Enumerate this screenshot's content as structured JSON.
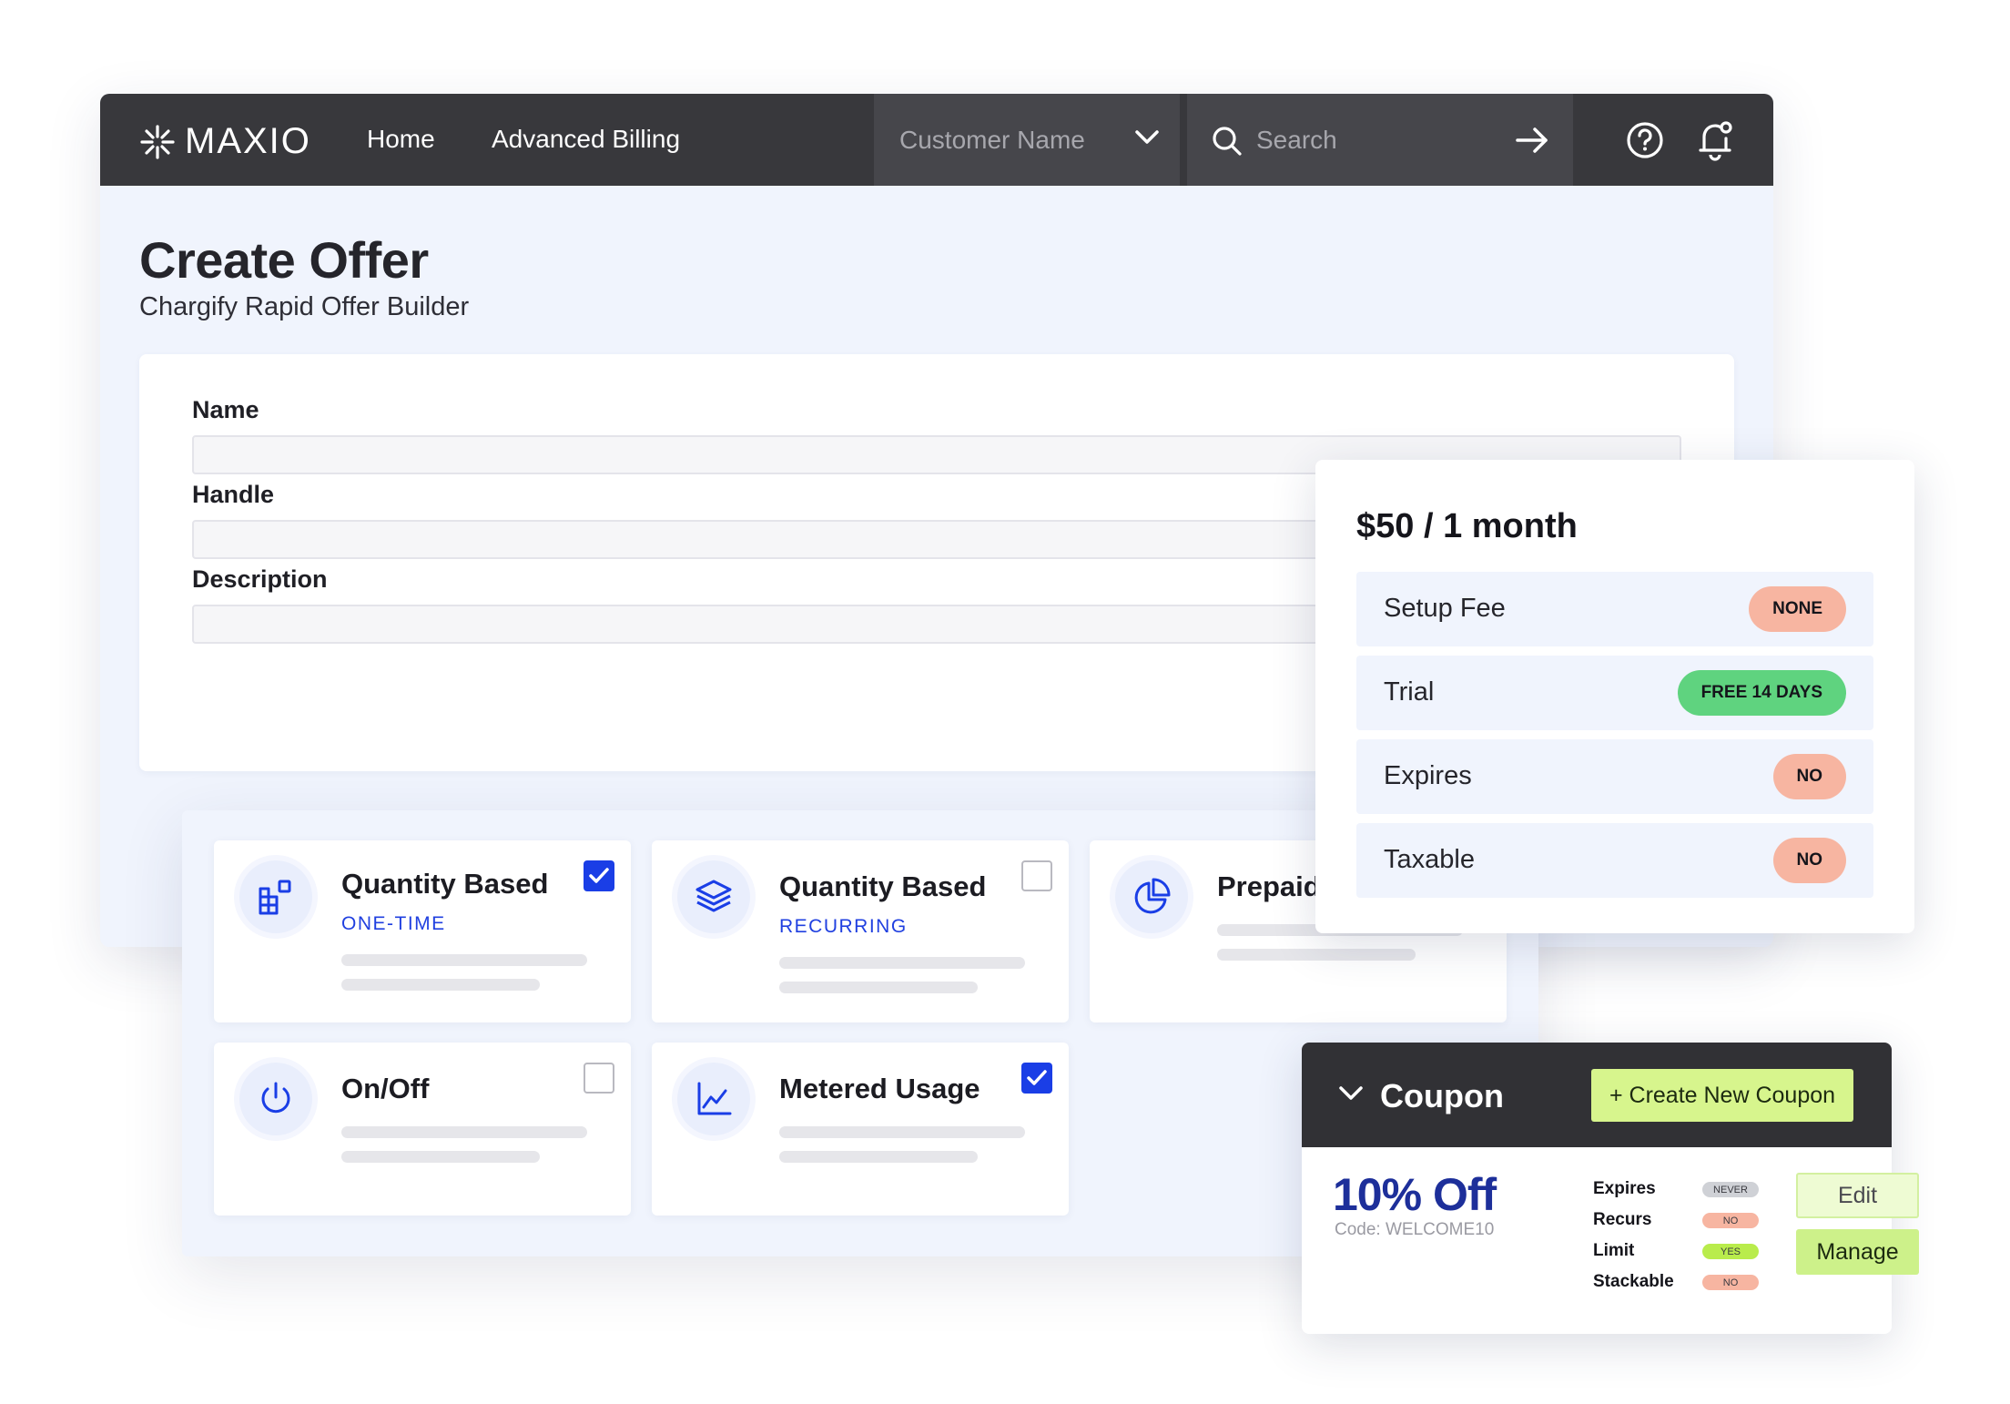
{
  "app": {
    "logo_text": "MAXIO",
    "nav": {
      "home": "Home",
      "advanced_billing": "Advanced Billing"
    },
    "customer_select": {
      "placeholder": "Customer Name"
    },
    "search": {
      "placeholder": "Search"
    },
    "icons": [
      "help-icon",
      "bell-icon",
      "search-icon",
      "arrow-right-icon",
      "chevron-down-icon"
    ]
  },
  "page": {
    "title": "Create Offer",
    "subtitle": "Chargify Rapid Offer Builder"
  },
  "form": {
    "fields": [
      {
        "label": "Name",
        "value": ""
      },
      {
        "label": "Handle",
        "value": ""
      },
      {
        "label": "Description",
        "value": ""
      }
    ]
  },
  "product_types": [
    {
      "title": "Quantity Based",
      "subtitle": "ONE-TIME",
      "checked": true,
      "icon": "blocks-icon"
    },
    {
      "title": "Quantity Based",
      "subtitle": "RECURRING",
      "checked": false,
      "icon": "layers-icon"
    },
    {
      "title": "Prepaid",
      "subtitle": "",
      "checked": false,
      "icon": "pie-chart-icon"
    },
    {
      "title": "On/Off",
      "subtitle": "",
      "checked": false,
      "icon": "power-icon"
    },
    {
      "title": "Metered Usage",
      "subtitle": "",
      "checked": true,
      "icon": "line-chart-icon"
    }
  ],
  "price": {
    "title": "$50 / 1 month",
    "rows": [
      {
        "label": "Setup Fee",
        "badge": "NONE",
        "badge_color": "#f7b5a1"
      },
      {
        "label": "Trial",
        "badge": "FREE 14 DAYS",
        "badge_color": "#5fd37f"
      },
      {
        "label": "Expires",
        "badge": "NO",
        "badge_color": "#f7b5a1"
      },
      {
        "label": "Taxable",
        "badge": "NO",
        "badge_color": "#f7b5a1"
      }
    ]
  },
  "coupon": {
    "title": "Coupon",
    "create_button": "+ Create New Coupon",
    "discount": "10% Off",
    "code": "Code: WELCOME10",
    "attributes": [
      {
        "label": "Expires",
        "value": "NEVER"
      },
      {
        "label": "Recurs",
        "value": "NO"
      },
      {
        "label": "Limit",
        "value": "YES"
      },
      {
        "label": "Stackable",
        "value": "NO"
      }
    ],
    "edit_button": "Edit",
    "manage_button": "Manage"
  },
  "colors": {
    "topbar": "#38383c",
    "accent_blue": "#1a3ee6",
    "lime": "#cdf18a",
    "salmon": "#f7b5a1",
    "green": "#5fd37f"
  }
}
